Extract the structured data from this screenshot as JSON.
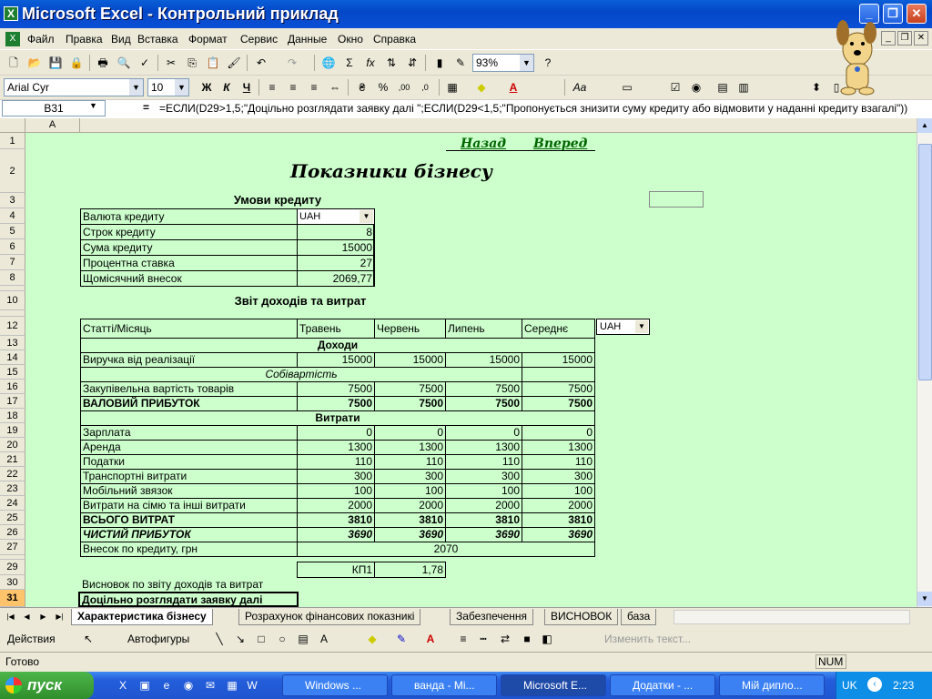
{
  "window": {
    "title": "Microsoft Excel - Контрольний приклад",
    "app_icon": "excel-icon"
  },
  "menu": [
    "Файл",
    "Правка",
    "Вид",
    "Вставка",
    "Формат",
    "Сервис",
    "Данные",
    "Окно",
    "Справка"
  ],
  "toolbar": {
    "zoom": "93%",
    "font": "Arial Cyr",
    "size": "10",
    "bold": "Ж",
    "italic": "К",
    "underline": "Ч"
  },
  "formula_bar": {
    "cell": "B31",
    "eq": "=",
    "formula": "=ЕСЛИ(D29>1,5;\"Доцільно розглядати заявку далі \";ЕСЛИ(D29<1,5;\"Пропонується знизити суму кредиту або відмовити у наданні кредиту взагалі\"))"
  },
  "grid": {
    "col_a": "A",
    "rows": [
      "1",
      "2",
      "3",
      "4",
      "5",
      "6",
      "7",
      "8",
      "9",
      "10",
      "11",
      "12",
      "13",
      "14",
      "15",
      "16",
      "17",
      "18",
      "19",
      "20",
      "21",
      "22",
      "23",
      "24",
      "25",
      "26",
      "27",
      "28",
      "29",
      "30",
      "31"
    ],
    "nav": {
      "back": "Назад",
      "forward": "Вперед"
    },
    "title": "Показники бізнесу",
    "credit_header": "Умови кредиту",
    "credit": [
      {
        "label": "Валюта кредиту",
        "value": "UAH"
      },
      {
        "label": "Строк кредиту",
        "value": "8"
      },
      {
        "label": "Сума кредиту",
        "value": "15000"
      },
      {
        "label": "Процентна ставка",
        "value": "27"
      },
      {
        "label": "Щомісячний внесок",
        "value": "2069,77"
      }
    ],
    "report_title": "Звіт доходів та витрат",
    "currency_select": "UAH",
    "headers": [
      "Статті/Місяць",
      "Травень",
      "Червень",
      "Липень",
      "Середнє"
    ],
    "sections": {
      "income": "Доходи",
      "cost": "Собівартість",
      "expenses": "Витрати"
    },
    "rows_data": [
      {
        "label": "Виручка від реалізації",
        "v": [
          "15000",
          "15000",
          "15000",
          "15000"
        ],
        "row": 14,
        "style": ""
      },
      {
        "label": "Закупівельна вартість товарів",
        "v": [
          "7500",
          "7500",
          "7500",
          "7500"
        ],
        "row": 16,
        "style": ""
      },
      {
        "label": "ВАЛОВИЙ ПРИБУТОК",
        "v": [
          "7500",
          "7500",
          "7500",
          "7500"
        ],
        "row": 17,
        "style": "b"
      },
      {
        "label": "Зарплата",
        "v": [
          "0",
          "0",
          "0",
          "0"
        ],
        "row": 19,
        "style": ""
      },
      {
        "label": "Аренда",
        "v": [
          "1300",
          "1300",
          "1300",
          "1300"
        ],
        "row": 20,
        "style": ""
      },
      {
        "label": "Податки",
        "v": [
          "110",
          "110",
          "110",
          "110"
        ],
        "row": 21,
        "style": ""
      },
      {
        "label": "Транспортні витрати",
        "v": [
          "300",
          "300",
          "300",
          "300"
        ],
        "row": 22,
        "style": ""
      },
      {
        "label": "Мобільний звязок",
        "v": [
          "100",
          "100",
          "100",
          "100"
        ],
        "row": 23,
        "style": ""
      },
      {
        "label": "Витрати на сімю та інші витрати",
        "v": [
          "2000",
          "2000",
          "2000",
          "2000"
        ],
        "row": 24,
        "style": ""
      },
      {
        "label": "ВСЬОГО ВИТРАТ",
        "v": [
          "3810",
          "3810",
          "3810",
          "3810"
        ],
        "row": 25,
        "style": "b"
      },
      {
        "label": "ЧИСТИЙ ПРИБУТОК",
        "v": [
          "3690",
          "3690",
          "3690",
          "3690"
        ],
        "row": 26,
        "style": "b i"
      }
    ],
    "loan_payment": {
      "label": "Внесок по кредиту, грн",
      "value": "2070"
    },
    "kp": {
      "label": "КП1",
      "value": "1,78"
    },
    "conclusion_label": "Висновок по звіту доходів та витрат",
    "conclusion": "Доцільно розглядати заявку далі"
  },
  "sheets": [
    "Характеристика бізнесу",
    "Розрахунок фінансових показникі",
    "Забезпечення",
    "ВИСНОВОК",
    "база"
  ],
  "drawing": {
    "actions": "Действия",
    "autoshapes": "Автофигуры",
    "edit_text": "Изменить текст..."
  },
  "status": {
    "ready": "Готово",
    "num": "NUM"
  },
  "taskbar": {
    "start": "пуск",
    "tasks": [
      "Windows ...",
      "ванда - Mi...",
      "Microsoft E...",
      "Додатки - ...",
      "Мій дипло..."
    ],
    "lang": "UK",
    "clock": "2:23"
  }
}
